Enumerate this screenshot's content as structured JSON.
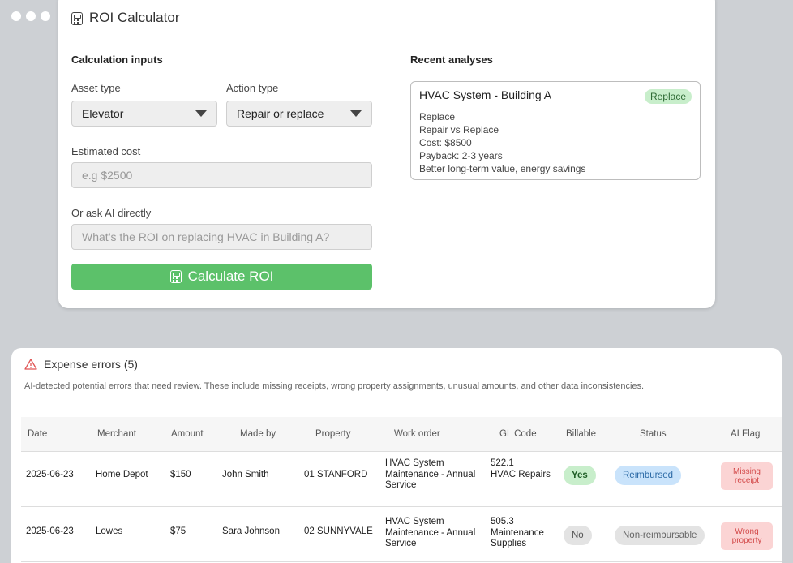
{
  "roi": {
    "title": "ROI Calculator",
    "inputs_heading": "Calculation inputs",
    "asset_type_label": "Asset type",
    "asset_type_value": "Elevator",
    "action_type_label": "Action type",
    "action_type_value": "Repair or replace",
    "estimated_cost_label": "Estimated cost",
    "estimated_cost_placeholder": "e.g $2500",
    "ask_ai_label": "Or ask AI directly",
    "ask_ai_placeholder": "What’s the ROI on replacing HVAC in Building A?",
    "calculate_button": "Calculate ROI",
    "recent_heading": "Recent analyses",
    "recent": {
      "title": "HVAC System - Building A",
      "badge": "Replace",
      "lines": [
        "Replace",
        "Repair vs Replace",
        "Cost: $8500",
        "Payback: 2-3 years",
        "Better long-term value, energy savings"
      ]
    }
  },
  "expenses": {
    "title": "Expense errors (5)",
    "description": "AI-detected potential errors that need review. These include missing receipts, wrong property assignments, unusual amounts, and other data inconsistencies.",
    "columns": [
      "Date",
      "Merchant",
      "Amount",
      "Made by",
      "Property",
      "Work order",
      "GL Code",
      "Billable",
      "Status",
      "AI Flag"
    ],
    "rows": [
      {
        "date": "2025-06-23",
        "merchant": "Home Depot",
        "amount": "$150",
        "made_by": "John Smith",
        "property": "01 STANFORD",
        "work_order": [
          "HVAC System",
          "Maintenance - Annual",
          "Service"
        ],
        "gl_code": [
          "522.1",
          "HVAC Repairs"
        ],
        "billable": "Yes",
        "status": "Reimbursed",
        "ai_flag": [
          "Missing",
          "receipt"
        ]
      },
      {
        "date": "2025-06-23",
        "merchant": "Lowes",
        "amount": "$75",
        "made_by": "Sara Johnson",
        "property": "02 SUNNYVALE",
        "work_order": [
          "HVAC System",
          "Maintenance - Annual",
          "Service"
        ],
        "gl_code": [
          "505.3",
          "Maintenance",
          "Supplies"
        ],
        "billable": "No",
        "status": "Non-reimbursable",
        "ai_flag": [
          "Wrong",
          "property"
        ]
      }
    ]
  }
}
